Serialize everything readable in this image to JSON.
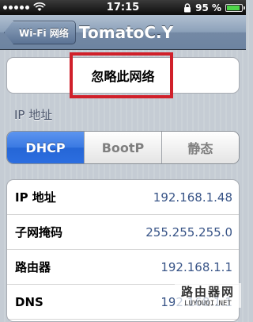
{
  "status_bar": {
    "time": "17:15",
    "battery_percent": "95 %",
    "battery_level": 0.95,
    "icons": [
      "carrier-dots-icon",
      "wifi-icon",
      "lock-icon",
      "battery-icon"
    ]
  },
  "nav": {
    "back_label": "Wi-Fi 网络",
    "title": "TomatoC.Y"
  },
  "forget_button": {
    "label": "忽略此网络"
  },
  "ip_section": {
    "label": "IP 地址"
  },
  "segmented": {
    "options": [
      "DHCP",
      "BootP",
      "静态"
    ],
    "selected": "DHCP"
  },
  "info_rows": [
    {
      "label": "IP 地址",
      "value": "192.168.1.48"
    },
    {
      "label": "子网掩码",
      "value": "255.255.255.0"
    },
    {
      "label": "路由器",
      "value": "192.168.1.1"
    },
    {
      "label": "DNS",
      "value": "192.168.1.1"
    }
  ],
  "watermark": {
    "line1": "路由器网",
    "line2": "LUYOUQI.NET"
  },
  "colors": {
    "highlight": "#d0202a",
    "selected_segment": "#2c6ee0",
    "value_text": "#385487"
  }
}
